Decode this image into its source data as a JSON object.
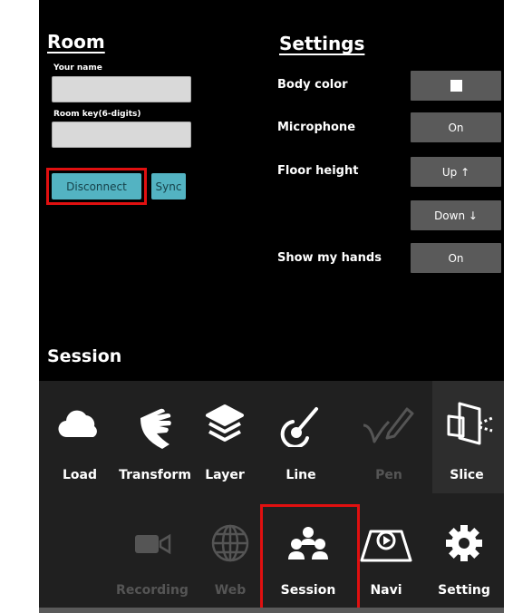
{
  "room": {
    "title": "Room",
    "your_name_label": "Your name",
    "room_key_label": "Room key(6-digits)",
    "your_name_value": "",
    "room_key_value": "",
    "disconnect_label": "Disconnect",
    "sync_label": "Sync"
  },
  "settings": {
    "title": "Settings",
    "body_color_label": "Body color",
    "body_color_value": "#ffffff",
    "microphone_label": "Microphone",
    "microphone_value": "On",
    "floor_height_label": "Floor height",
    "floor_up_label": "Up ↑",
    "floor_down_label": "Down ↓",
    "show_hands_label": "Show my hands",
    "show_hands_value": "On"
  },
  "section_title": "Session",
  "tools_row1": [
    {
      "label": "Load",
      "icon": "cloud-icon",
      "enabled": true
    },
    {
      "label": "Transform",
      "icon": "hand-icon",
      "enabled": true
    },
    {
      "label": "Layer",
      "icon": "layers-icon",
      "enabled": true
    },
    {
      "label": "Line",
      "icon": "line-icon",
      "enabled": true
    },
    {
      "label": "Pen",
      "icon": "pen-icon",
      "enabled": false
    },
    {
      "label": "Slice",
      "icon": "slice-icon",
      "enabled": true
    }
  ],
  "tools_row2": [
    {
      "label": "Recording",
      "icon": "video-camera-icon",
      "enabled": false
    },
    {
      "label": "Web",
      "icon": "globe-icon",
      "enabled": false
    },
    {
      "label": "Session",
      "icon": "people-icon",
      "enabled": true
    },
    {
      "label": "Navi",
      "icon": "navi-icon",
      "enabled": true
    },
    {
      "label": "Setting",
      "icon": "gear-icon",
      "enabled": true
    }
  ],
  "colors": {
    "accent": "#53b3c2",
    "highlight": "#e01010",
    "panel": "#000000",
    "button": "#5a5a5a"
  }
}
